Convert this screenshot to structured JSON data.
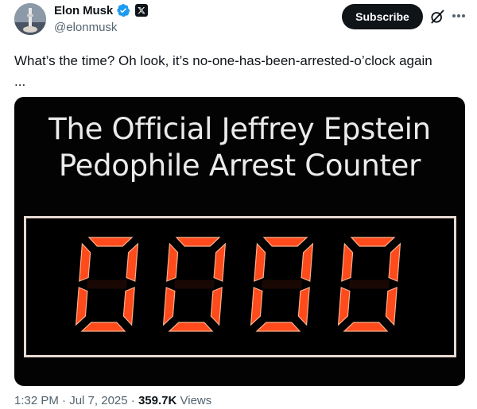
{
  "author": {
    "display_name": "Elon Musk",
    "handle": "@elonmusk",
    "avatar_icon": "avatar-image",
    "verified_icon": "verified-badge-icon",
    "affiliation_icon": "x-logo-icon"
  },
  "header": {
    "subscribe_label": "Subscribe",
    "grok_icon": "grok-icon",
    "more_icon": "more-options-icon"
  },
  "tweet": {
    "text": "What’s the time? Oh look, it’s no-one-has-been-arrested-o’clock again\n..."
  },
  "media": {
    "title_line1": "The Official Jeffrey Epstein",
    "title_line2": "Pedophile Arrest Counter",
    "counter_value": "0000",
    "digit_color": "#ff4a1c"
  },
  "meta": {
    "time": "1:32 PM",
    "date": "Jul 7, 2025",
    "views_count": "359.7K",
    "views_label": "Views",
    "separator": "·"
  },
  "colors": {
    "accent_blue": "#1d9bf0",
    "text_primary": "#0f1419",
    "text_secondary": "#536471"
  }
}
